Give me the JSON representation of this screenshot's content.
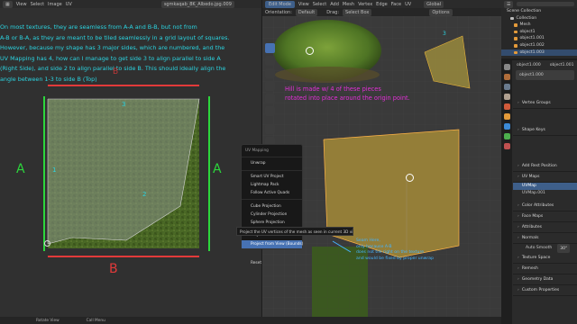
{
  "uv_editor": {
    "header": [
      "Object Mode",
      "Image",
      "UV"
    ],
    "image_name": "sgmkaqab_8K_Albedo.jpg.009",
    "view_label": "View",
    "select_label": "Select",
    "note": [
      "On most textures, they are seamless from A-A and B-B, but not from",
      "A-B or B-A, as they are meant to be tiled seamlessly in a grid layout of squares.",
      "However, because my shape has 3 major sides, which are numbered, and the",
      "UV Mapping has 4, how can I manage to get side 3 to align parallel to side A",
      "(Right Side), and side 2 to align parallel to side B. This should ideally align the",
      "angle between 1-3 to side B (Top)"
    ],
    "label_a_left": "A",
    "label_a_right": "A",
    "label_b_bottom": "B",
    "label_b_top": "B",
    "side_1": "1",
    "side_2": "2",
    "side_3": "3"
  },
  "viewport": {
    "header": [
      "Edit Mode",
      "View",
      "Select",
      "Add",
      "Mesh",
      "Vertex",
      "Edge",
      "Face",
      "UV"
    ],
    "orientation_label": "Orientation:",
    "orientation_value": "Default",
    "drag_label": "Drag:",
    "drag_value": "Select Box",
    "transform_value": "Global",
    "options_label": "Options",
    "hill_note": [
      "Hill is made w/ 4 of these pieces",
      "rotated into place around the origin point."
    ],
    "seam_note": [
      "Seam Here,",
      "only because A-B",
      "does not tile right on the texture",
      "and would be fixed by proper unwrap"
    ],
    "corner_label": "3"
  },
  "uv_menu": {
    "title": "UV Mapping",
    "items": [
      "Unwrap",
      "Smart UV Project",
      "Lightmap Pack",
      "Follow Active Quads",
      "Cube Projection",
      "Cylinder Projection",
      "Sphere Projection",
      "Project from View",
      "Project from View (Bounds)",
      "Reset"
    ],
    "highlighted": "Project from View (Bounds)",
    "tooltip": "Project the UV vertices of the mesh as seen in current 3D view."
  },
  "outliner": {
    "title": "Scene Collection",
    "rows": [
      "Collection",
      "Mesh",
      "object1",
      "object1.001",
      "object1.002",
      "object1.003"
    ]
  },
  "properties": {
    "object_name": "object1.000",
    "mesh_name": "object1.001",
    "data_name": "object1.000",
    "panels": [
      "Vertex Groups",
      "Shape Keys",
      "Add Rest Position",
      "UV Maps",
      "UVMap",
      "UVMap.001",
      "Color Attributes",
      "Face Maps",
      "Attributes",
      "Normals",
      "Auto Smooth",
      "Texture Space",
      "Remesh",
      "Geometry Data",
      "Custom Properties"
    ],
    "auto_smooth_value": "30°"
  },
  "status": [
    "Rotate View",
    "Call Menu"
  ],
  "colors": {
    "note_text": "#2bd3e0",
    "hill_text": "#e32fd8",
    "annot_green": "#2cd63c",
    "annot_red": "#e23a3a",
    "seam_blue": "#44b4ff",
    "menu_highlight": "#4772b3"
  }
}
